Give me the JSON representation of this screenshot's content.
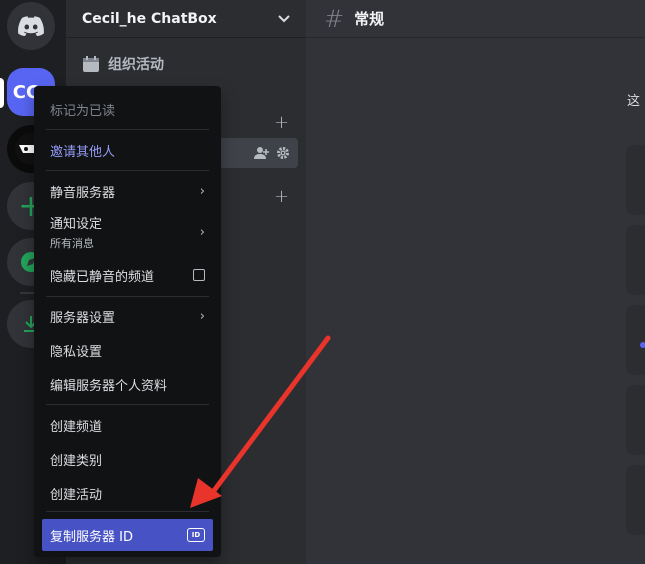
{
  "server": {
    "name": "Cecil_he ChatBox",
    "initials": "CC"
  },
  "sidebar": {
    "events_label": "组织活动"
  },
  "channel": {
    "title": "常规"
  },
  "main": {
    "partial_text": "这"
  },
  "context_menu": {
    "mark_read": "标记为已读",
    "invite": "邀请其他人",
    "mute_server": "静音服务器",
    "notification_settings": "通知设定",
    "notification_sub": "所有消息",
    "hide_muted": "隐藏已静音的频道",
    "server_settings": "服务器设置",
    "privacy_settings": "隐私设置",
    "edit_profile": "编辑服务器个人资料",
    "create_channel": "创建频道",
    "create_category": "创建类别",
    "create_event": "创建活动",
    "copy_server_id": "复制服务器 ID",
    "id_badge": "ID"
  },
  "icons": {
    "discord_logo": "discord-logo-icon",
    "add_server": "plus-icon",
    "explore": "compass-icon",
    "download": "download-icon",
    "chevron": "chevron-right-icon",
    "calendar": "calendar-icon",
    "hash": "hash-icon",
    "gear": "gear-icon",
    "invite_member": "add-member-icon"
  },
  "colors": {
    "blurple": "#5865f2",
    "highlight": "#4752c4",
    "accent_text": "#949cf7",
    "green": "#23a55a",
    "arrow_red": "#e8342a"
  }
}
